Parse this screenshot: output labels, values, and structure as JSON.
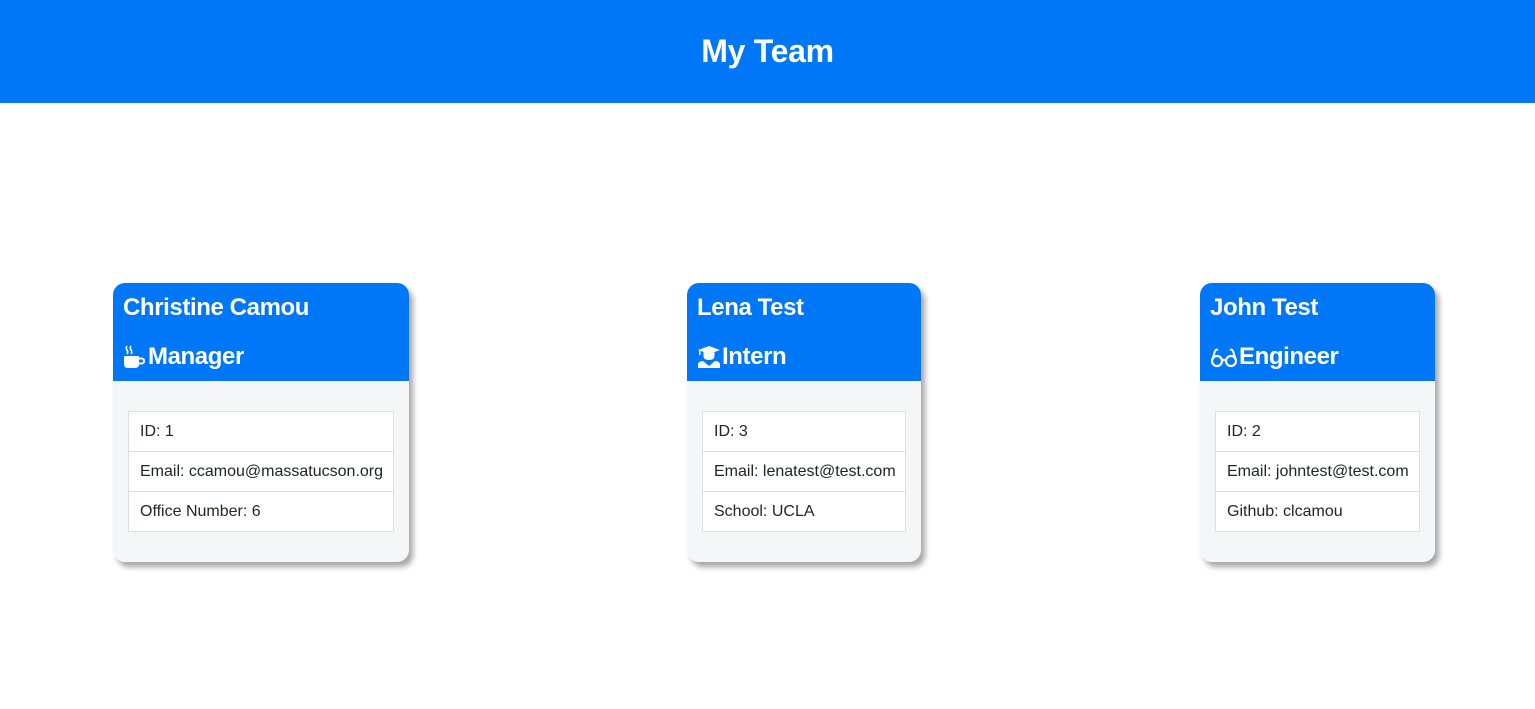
{
  "header": {
    "title": "My Team"
  },
  "colors": {
    "accent": "#0077f7",
    "card_body": "#f5f6f8"
  },
  "team": [
    {
      "name": "Christine Camou",
      "role": "Manager",
      "role_icon": "mug-icon",
      "details": [
        {
          "label": "ID:",
          "value": "1"
        },
        {
          "label": "Email:",
          "value": "ccamou@massatucson.org"
        },
        {
          "label": "Office Number:",
          "value": "6"
        }
      ]
    },
    {
      "name": "Lena Test",
      "role": "Intern",
      "role_icon": "graduate-icon",
      "details": [
        {
          "label": "ID:",
          "value": "3"
        },
        {
          "label": "Email:",
          "value": "lenatest@test.com"
        },
        {
          "label": "School:",
          "value": "UCLA"
        }
      ]
    },
    {
      "name": "John Test",
      "role": "Engineer",
      "role_icon": "glasses-icon",
      "details": [
        {
          "label": "ID:",
          "value": "2"
        },
        {
          "label": "Email:",
          "value": "johntest@test.com"
        },
        {
          "label": "Github:",
          "value": "clcamou"
        }
      ]
    }
  ]
}
